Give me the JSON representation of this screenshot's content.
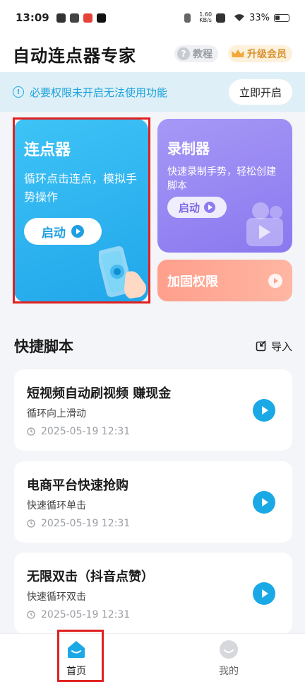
{
  "status_bar": {
    "time": "13:09",
    "net_speed_value": "1.60",
    "net_speed_unit": "KB/s",
    "battery": "33%"
  },
  "header": {
    "title": "自动连点器专家",
    "tutorial_label": "教程",
    "vip_label": "升级会员"
  },
  "permission_banner": {
    "message": "必要权限未开启无法使用功能",
    "button_label": "立即开启"
  },
  "features": {
    "clicker": {
      "title": "连点器",
      "description": "循环点击连点，模拟手势操作",
      "button_label": "启动"
    },
    "recorder": {
      "title": "录制器",
      "description": "快速录制手势，轻松创建脚本",
      "button_label": "启动"
    },
    "harden": {
      "title": "加固权限"
    }
  },
  "quick_scripts": {
    "title": "快捷脚本",
    "import_label": "导入",
    "items": [
      {
        "name": "短视频自动刷视频 赚现金",
        "mode": "循环向上滑动",
        "time": "2025-05-19 12:31"
      },
      {
        "name": "电商平台快速抢购",
        "mode": "快速循环单击",
        "time": "2025-05-19 12:31"
      },
      {
        "name": "无限双击（抖音点赞）",
        "mode": "快速循环双击",
        "time": "2025-05-19 12:31"
      }
    ]
  },
  "bottom_nav": {
    "home_label": "首页",
    "mine_label": "我的"
  },
  "colors": {
    "primary_blue": "#1ba9e6",
    "recorder_purple": "#8a78ef",
    "harden_salmon": "#ff9f8c",
    "highlight_red": "#e02020"
  }
}
